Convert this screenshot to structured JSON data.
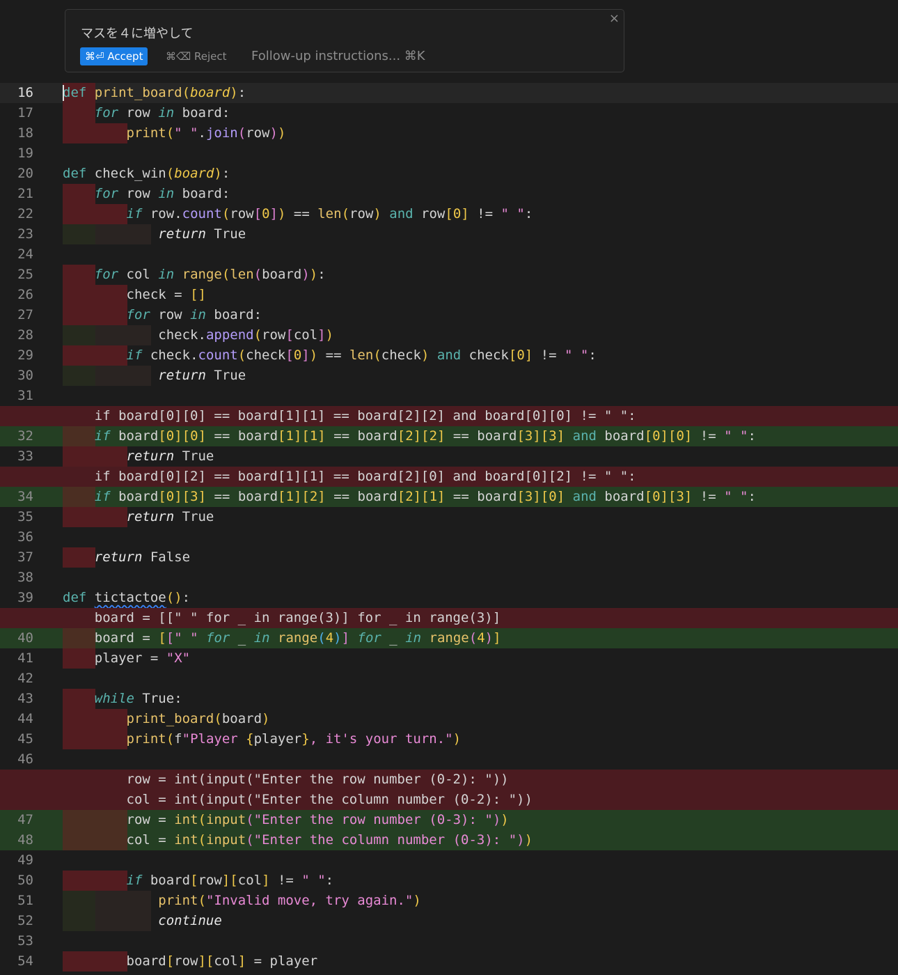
{
  "prompt": {
    "text": "マスを４に増やして",
    "accept_label": "⌘⏎ Accept",
    "reject_label": "⌘⌫ Reject",
    "followup_placeholder": "Follow-up instructions... ⌘K",
    "close_icon": "×"
  },
  "colors": {
    "deleted_bg": "#4b1b20",
    "added_bg": "#243f23",
    "accept_button": "#1b7fe6"
  },
  "lines": [
    {
      "n": "16",
      "type": "cur",
      "code": "def print_board(board):",
      "active": true,
      "gut": [
        1
      ]
    },
    {
      "n": "17",
      "type": "",
      "code": "    for row in board:",
      "gut": [
        1
      ]
    },
    {
      "n": "18",
      "type": "",
      "code": "        print(\" \".join(row))",
      "gut": [
        2
      ]
    },
    {
      "n": "19",
      "type": "",
      "code": "",
      "gut": []
    },
    {
      "n": "20",
      "type": "",
      "code": "def check_win(board):",
      "gut": []
    },
    {
      "n": "21",
      "type": "",
      "code": "    for row in board:",
      "gut": [
        1
      ]
    },
    {
      "n": "22",
      "type": "",
      "code": "        if row.count(row[0]) == len(row) and row[0] != \" \":",
      "gut": [
        2
      ]
    },
    {
      "n": "23",
      "type": "",
      "code": "            return True",
      "gut": [
        3
      ]
    },
    {
      "n": "24",
      "type": "",
      "code": "",
      "gut": []
    },
    {
      "n": "25",
      "type": "",
      "code": "    for col in range(len(board)):",
      "gut": [
        1
      ]
    },
    {
      "n": "26",
      "type": "",
      "code": "        check = []",
      "gut": [
        2
      ]
    },
    {
      "n": "27",
      "type": "",
      "code": "        for row in board:",
      "gut": [
        2
      ]
    },
    {
      "n": "28",
      "type": "",
      "code": "            check.append(row[col])",
      "gut": [
        3
      ]
    },
    {
      "n": "29",
      "type": "",
      "code": "        if check.count(check[0]) == len(check) and check[0] != \" \":",
      "gut": [
        2
      ]
    },
    {
      "n": "30",
      "type": "",
      "code": "            return True",
      "gut": [
        3
      ]
    },
    {
      "n": "31",
      "type": "",
      "code": "",
      "gut": []
    },
    {
      "n": "",
      "type": "del",
      "code": "    if board[0][0] == board[1][1] == board[2][2] and board[0][0] != \" \":",
      "gut": []
    },
    {
      "n": "32",
      "type": "add",
      "code": "    if board[0][0] == board[1][1] == board[2][2] == board[3][3] and board[0][0] != \" \":",
      "gut": [
        1
      ]
    },
    {
      "n": "33",
      "type": "",
      "code": "        return True",
      "gut": [
        2
      ]
    },
    {
      "n": "",
      "type": "del",
      "code": "    if board[0][2] == board[1][1] == board[2][0] and board[0][2] != \" \":",
      "gut": []
    },
    {
      "n": "34",
      "type": "add",
      "code": "    if board[0][3] == board[1][2] == board[2][1] == board[3][0] and board[0][3] != \" \":",
      "gut": [
        1
      ]
    },
    {
      "n": "35",
      "type": "",
      "code": "        return True",
      "gut": [
        2
      ]
    },
    {
      "n": "36",
      "type": "",
      "code": "",
      "gut": []
    },
    {
      "n": "37",
      "type": "",
      "code": "    return False",
      "gut": [
        1
      ]
    },
    {
      "n": "38",
      "type": "",
      "code": "",
      "gut": []
    },
    {
      "n": "39",
      "type": "",
      "code": "def tictactoe():",
      "gut": []
    },
    {
      "n": "",
      "type": "del",
      "code": "    board = [[\" \" for _ in range(3)] for _ in range(3)]",
      "gut": []
    },
    {
      "n": "40",
      "type": "add",
      "code": "    board = [[\" \" for _ in range(4)] for _ in range(4)]",
      "gut": [
        1
      ]
    },
    {
      "n": "41",
      "type": "",
      "code": "    player = \"X\"",
      "gut": [
        1
      ]
    },
    {
      "n": "42",
      "type": "",
      "code": "",
      "gut": []
    },
    {
      "n": "43",
      "type": "",
      "code": "    while True:",
      "gut": [
        1
      ]
    },
    {
      "n": "44",
      "type": "",
      "code": "        print_board(board)",
      "gut": [
        2
      ]
    },
    {
      "n": "45",
      "type": "",
      "code": "        print(f\"Player {player}, it's your turn.\")",
      "gut": [
        2
      ]
    },
    {
      "n": "46",
      "type": "",
      "code": "",
      "gut": []
    },
    {
      "n": "",
      "type": "del",
      "code": "        row = int(input(\"Enter the row number (0-2): \"))",
      "gut": []
    },
    {
      "n": "",
      "type": "del",
      "code": "        col = int(input(\"Enter the column number (0-2): \"))",
      "gut": []
    },
    {
      "n": "47",
      "type": "add",
      "code": "        row = int(input(\"Enter the row number (0-3): \"))",
      "gut": [
        2
      ]
    },
    {
      "n": "48",
      "type": "add",
      "code": "        col = int(input(\"Enter the column number (0-3): \"))",
      "gut": [
        2
      ]
    },
    {
      "n": "49",
      "type": "",
      "code": "",
      "gut": []
    },
    {
      "n": "50",
      "type": "",
      "code": "        if board[row][col] != \" \":",
      "gut": [
        2
      ]
    },
    {
      "n": "51",
      "type": "",
      "code": "            print(\"Invalid move, try again.\")",
      "gut": [
        3
      ]
    },
    {
      "n": "52",
      "type": "",
      "code": "            continue",
      "gut": [
        3
      ]
    },
    {
      "n": "53",
      "type": "",
      "code": "",
      "gut": []
    },
    {
      "n": "54",
      "type": "",
      "code": "        board[row][col] = player",
      "gut": [
        2
      ]
    }
  ]
}
